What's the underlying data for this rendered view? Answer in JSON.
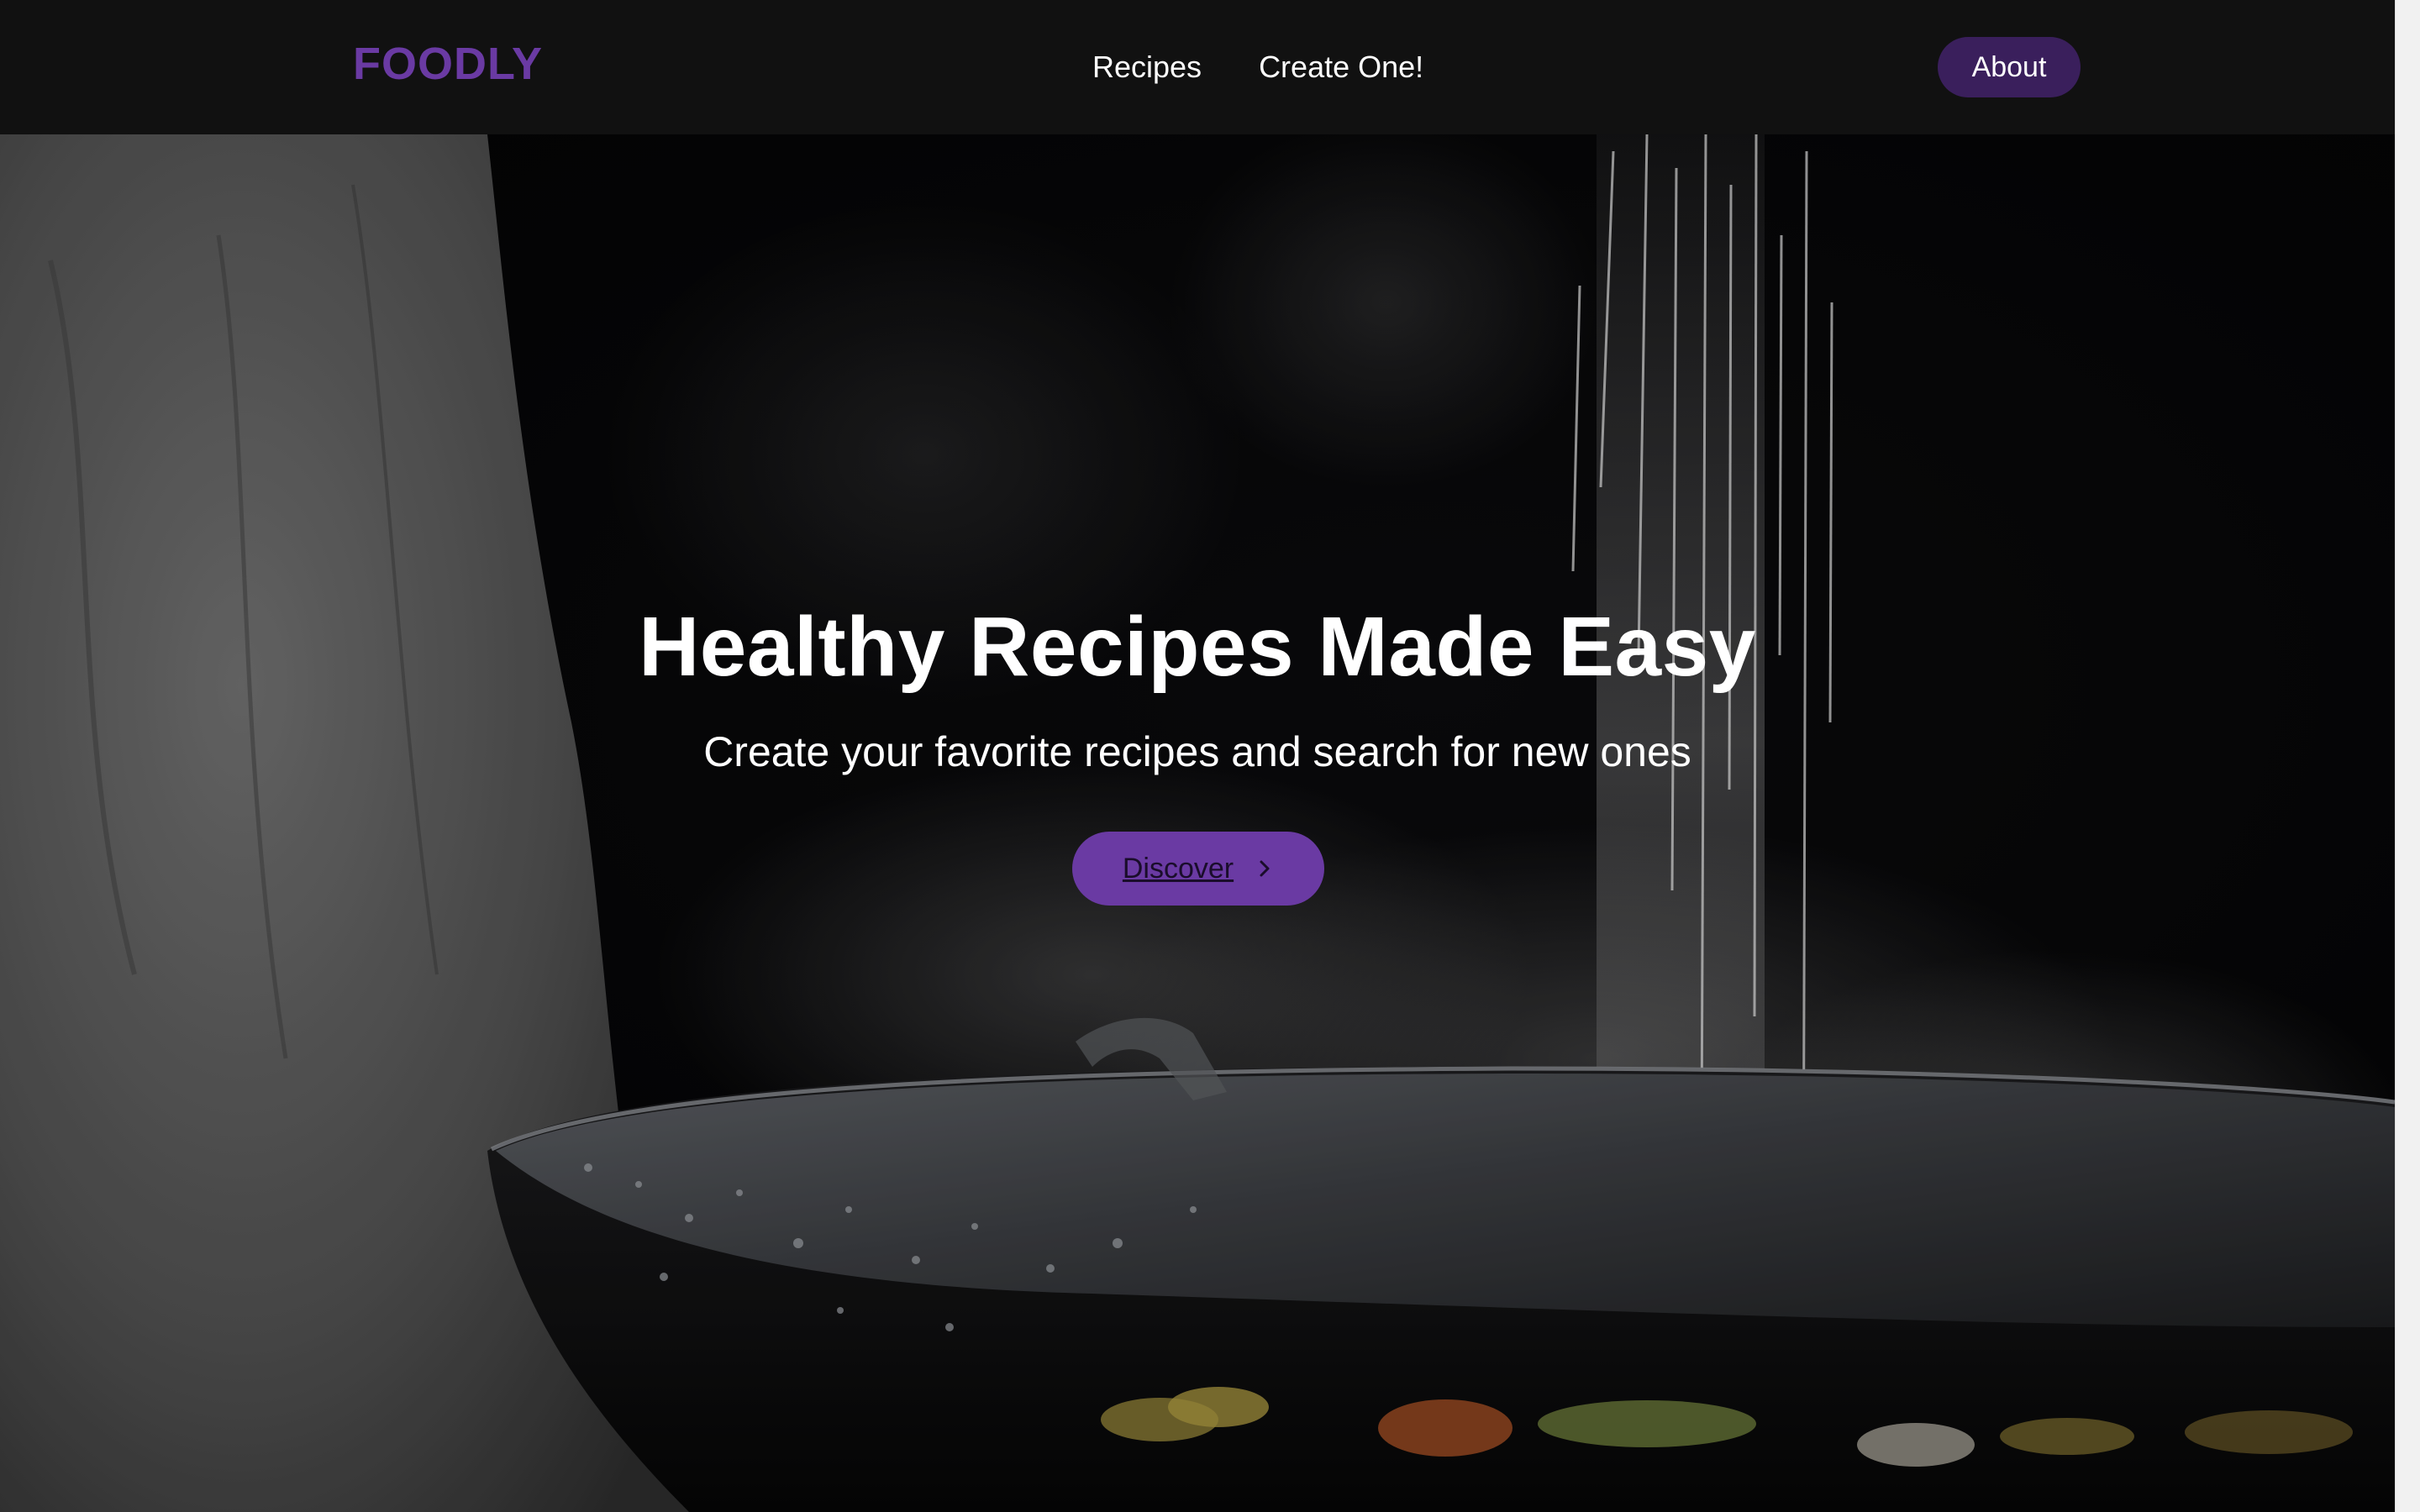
{
  "nav": {
    "logo": "FOODLY",
    "links": [
      {
        "label": "Recipes"
      },
      {
        "label": "Create One!"
      }
    ],
    "about_label": "About"
  },
  "hero": {
    "title": "Healthy Recipes Made Easy",
    "subtitle": "Create your favorite recipes and search for new ones",
    "cta_label": "Discover",
    "cta_icon": "chevron-right-icon",
    "background_image": "chef-sprinkling-salt-into-steaming-wok"
  },
  "colors": {
    "brand": "#6a3aa3",
    "about_button": "#3a1f5c",
    "navbar": "#111111",
    "text": "#ffffff"
  }
}
